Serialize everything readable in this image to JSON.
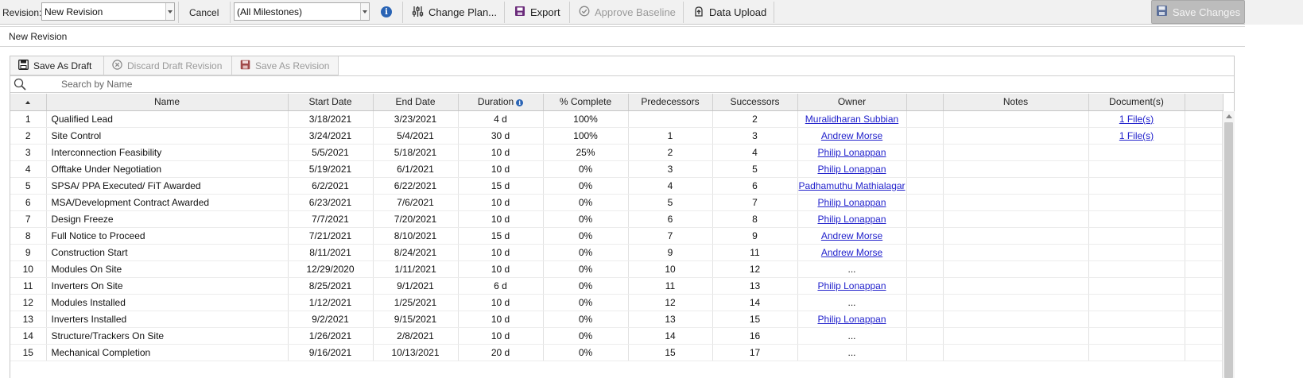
{
  "toolbar": {
    "revision_label": "Revision:",
    "revision_value": "New Revision",
    "cancel_label": "Cancel",
    "milestones_value": "(All Milestones)",
    "info_glyph": "i",
    "change_plan_label": "Change Plan...",
    "export_label": "Export",
    "approve_baseline_label": "Approve Baseline",
    "data_upload_label": "Data Upload",
    "save_changes_label": "Save Changes"
  },
  "subheader": {
    "title": "New Revision"
  },
  "panel": {
    "save_as_draft_label": "Save As Draft",
    "discard_draft_label": "Discard Draft Revision",
    "save_as_revision_label": "Save As Revision",
    "search_placeholder": "Search by Name"
  },
  "columns": {
    "name": "Name",
    "start": "Start Date",
    "end": "End Date",
    "duration": "Duration",
    "complete": "% Complete",
    "predecessors": "Predecessors",
    "successors": "Successors",
    "owner": "Owner",
    "blank": "",
    "notes": "Notes",
    "documents": "Document(s)"
  },
  "rows": [
    {
      "num": "1",
      "name": "Qualified Lead",
      "start": "3/18/2021",
      "end": "3/23/2021",
      "duration": "4 d",
      "complete": "100%",
      "pred": "",
      "succ": "2",
      "owner": "Muralidharan Subbian",
      "owner_link": true,
      "notes": "",
      "docs": "1 File(s)"
    },
    {
      "num": "2",
      "name": "Site Control",
      "start": "3/24/2021",
      "end": "5/4/2021",
      "duration": "30 d",
      "complete": "100%",
      "pred": "1",
      "succ": "3",
      "owner": "Andrew Morse",
      "owner_link": true,
      "notes": "",
      "docs": "1 File(s)"
    },
    {
      "num": "3",
      "name": "Interconnection Feasibility",
      "start": "5/5/2021",
      "end": "5/18/2021",
      "duration": "10 d",
      "complete": "25%",
      "pred": "2",
      "succ": "4",
      "owner": "Philip Lonappan",
      "owner_link": true,
      "notes": "",
      "docs": ""
    },
    {
      "num": "4",
      "name": "Offtake Under Negotiation",
      "start": "5/19/2021",
      "end": "6/1/2021",
      "duration": "10 d",
      "complete": "0%",
      "pred": "3",
      "succ": "5",
      "owner": "Philip Lonappan",
      "owner_link": true,
      "notes": "",
      "docs": ""
    },
    {
      "num": "5",
      "name": "SPSA/ PPA Executed/ FiT Awarded",
      "start": "6/2/2021",
      "end": "6/22/2021",
      "duration": "15 d",
      "complete": "0%",
      "pred": "4",
      "succ": "6",
      "owner": "Padhamuthu Mathialagar",
      "owner_link": true,
      "notes": "",
      "docs": ""
    },
    {
      "num": "6",
      "name": "MSA/Development Contract Awarded",
      "start": "6/23/2021",
      "end": "7/6/2021",
      "duration": "10 d",
      "complete": "0%",
      "pred": "5",
      "succ": "7",
      "owner": "Philip Lonappan",
      "owner_link": true,
      "notes": "",
      "docs": ""
    },
    {
      "num": "7",
      "name": "Design Freeze",
      "start": "7/7/2021",
      "end": "7/20/2021",
      "duration": "10 d",
      "complete": "0%",
      "pred": "6",
      "succ": "8",
      "owner": "Philip Lonappan",
      "owner_link": true,
      "notes": "",
      "docs": ""
    },
    {
      "num": "8",
      "name": "Full Notice to Proceed",
      "start": "7/21/2021",
      "end": "8/10/2021",
      "duration": "15 d",
      "complete": "0%",
      "pred": "7",
      "succ": "9",
      "owner": "Andrew Morse",
      "owner_link": true,
      "notes": "",
      "docs": ""
    },
    {
      "num": "9",
      "name": "Construction Start",
      "start": "8/11/2021",
      "end": "8/24/2021",
      "duration": "10 d",
      "complete": "0%",
      "pred": "9",
      "succ": "11",
      "owner": "Andrew Morse",
      "owner_link": true,
      "notes": "",
      "docs": ""
    },
    {
      "num": "10",
      "name": "Modules On Site",
      "start": "12/29/2020",
      "end": "1/11/2021",
      "duration": "10 d",
      "complete": "0%",
      "pred": "10",
      "succ": "12",
      "owner": "...",
      "owner_link": false,
      "notes": "",
      "docs": ""
    },
    {
      "num": "11",
      "name": "Inverters On Site",
      "start": "8/25/2021",
      "end": "9/1/2021",
      "duration": "6 d",
      "complete": "0%",
      "pred": "11",
      "succ": "13",
      "owner": "Philip Lonappan",
      "owner_link": true,
      "notes": "",
      "docs": ""
    },
    {
      "num": "12",
      "name": "Modules Installed",
      "start": "1/12/2021",
      "end": "1/25/2021",
      "duration": "10 d",
      "complete": "0%",
      "pred": "12",
      "succ": "14",
      "owner": "...",
      "owner_link": false,
      "notes": "",
      "docs": ""
    },
    {
      "num": "13",
      "name": "Inverters Installed",
      "start": "9/2/2021",
      "end": "9/15/2021",
      "duration": "10 d",
      "complete": "0%",
      "pred": "13",
      "succ": "15",
      "owner": "Philip Lonappan",
      "owner_link": true,
      "notes": "",
      "docs": ""
    },
    {
      "num": "14",
      "name": "Structure/Trackers On Site",
      "start": "1/26/2021",
      "end": "2/8/2021",
      "duration": "10 d",
      "complete": "0%",
      "pred": "14",
      "succ": "16",
      "owner": "...",
      "owner_link": false,
      "notes": "",
      "docs": ""
    },
    {
      "num": "15",
      "name": "Mechanical Completion",
      "start": "9/16/2021",
      "end": "10/13/2021",
      "duration": "20 d",
      "complete": "0%",
      "pred": "15",
      "succ": "17",
      "owner": "...",
      "owner_link": false,
      "notes": "",
      "docs": ""
    }
  ],
  "colors": {
    "link": "#2222cc",
    "accent_blue": "#2a64b5",
    "save_changes_bg": "#bcbcbc",
    "toolbar_bg": "#f1f1f1",
    "export_icon": "#6a2a7a"
  },
  "icons": {
    "change_plan": "sliders-icon",
    "export": "export-icon",
    "approve": "check-circle-icon",
    "upload": "upload-icon",
    "save": "floppy-disk-icon",
    "discard": "x-circle-icon",
    "search": "search-icon"
  }
}
